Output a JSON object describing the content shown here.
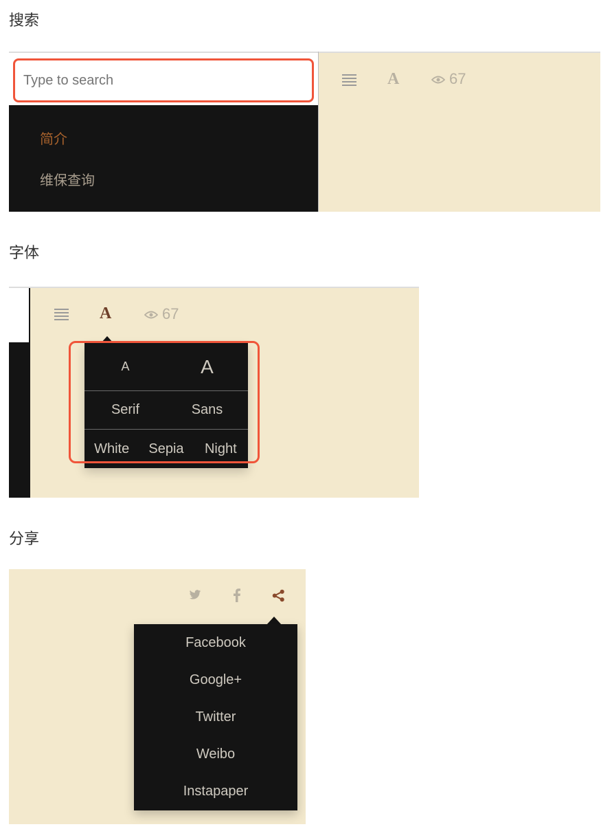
{
  "sections": {
    "search_heading": "搜索",
    "font_heading": "字体",
    "share_heading": "分享"
  },
  "search": {
    "placeholder": "Type to search",
    "sidebar_items": [
      {
        "label": "简介",
        "color": "#a8622c",
        "active": true
      },
      {
        "label": "维保查询",
        "color": "#a99e8e",
        "active": false
      }
    ],
    "views": "67"
  },
  "font_panel": {
    "views": "67",
    "size_options": [
      "A",
      "A"
    ],
    "family_options": [
      "Serif",
      "Sans"
    ],
    "theme_options": [
      "White",
      "Sepia",
      "Night"
    ]
  },
  "share": {
    "icons": [
      "twitter-icon",
      "facebook-icon",
      "share-icon"
    ],
    "menu_items": [
      "Facebook",
      "Google+",
      "Twitter",
      "Weibo",
      "Instapaper"
    ]
  },
  "colors": {
    "reader_background": "#f3e9cd",
    "panel_background": "#141414",
    "highlight": "#f0553a",
    "accent": "#8a4a2c",
    "icon_muted": "#b8b1a1"
  }
}
